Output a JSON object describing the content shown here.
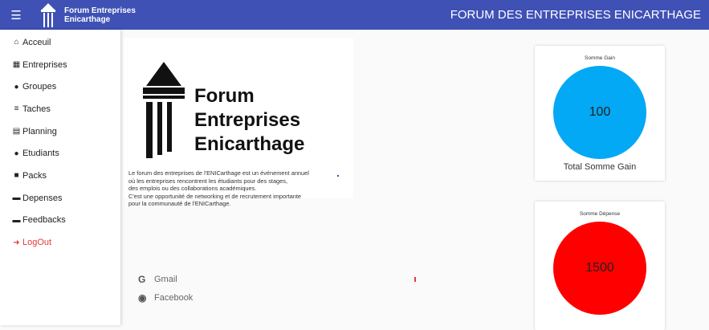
{
  "header": {
    "brand_line1": "Forum Entreprises",
    "brand_line2": "Enicarthage",
    "title": "FORUM DES ENTREPRISES ENICARTHAGE",
    "bg": "#3f51b5"
  },
  "sidebar": {
    "items": [
      {
        "label": "Acceuil",
        "icon": "home-icon"
      },
      {
        "label": "Entreprises",
        "icon": "building-icon"
      },
      {
        "label": "Groupes",
        "icon": "users-icon"
      },
      {
        "label": "Taches",
        "icon": "list-icon"
      },
      {
        "label": "Planning",
        "icon": "calendar-icon"
      },
      {
        "label": "Etudiants",
        "icon": "users-icon"
      },
      {
        "label": "Packs",
        "icon": "briefcase-icon"
      },
      {
        "label": "Depenses",
        "icon": "money-icon"
      },
      {
        "label": "Feedbacks",
        "icon": "comment-icon"
      },
      {
        "label": "LogOut",
        "icon": "logout-icon"
      }
    ]
  },
  "main": {
    "logo_line1": "Forum Entreprises",
    "logo_line2": "Enicarthage",
    "description": [
      "Le forum des entreprises de l'ENICarthage est un événement annuel",
      "où les entreprises rencontrent les étudiants pour des stages,",
      "des emplois ou des collaborations académiques.",
      "C'est une opportunité de networking et de recrutement importante",
      "pour la communauté de l'ENICarthage."
    ],
    "social": [
      {
        "label": "Gmail",
        "icon": "google-icon"
      },
      {
        "label": "Facebook",
        "icon": "facebook-icon"
      }
    ]
  },
  "stats": {
    "gain": {
      "title": "Somme Gain",
      "value": "100",
      "footer": "Total Somme Gain",
      "color": "#03a9f4"
    },
    "depense": {
      "title": "Somme Dépense",
      "value": "1500",
      "color": "#ff0000"
    }
  }
}
